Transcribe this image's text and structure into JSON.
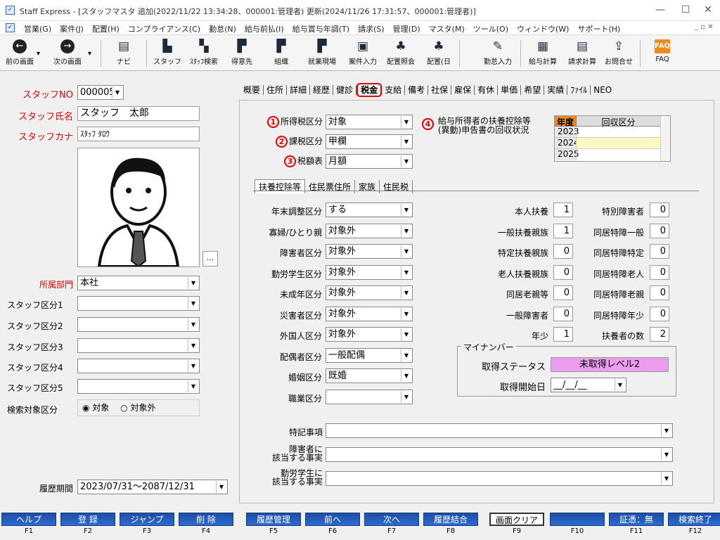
{
  "window": {
    "title": "Staff Express - [スタッフマスタ 追加(2022/11/22 13:34:28、000001:管理者) 更新(2024/11/26 17:31:57、000001:管理者)]"
  },
  "menu": [
    "営業(G)",
    "案件(J)",
    "配置(H)",
    "コンプライアンス(C)",
    "勤怠(N)",
    "給与前払(I)",
    "給与賞与年調(T)",
    "請求(S)",
    "管理(D)",
    "マスタ(M)",
    "ツール(O)",
    "ウィンドウ(W)",
    "サポート(H)"
  ],
  "toolbar": [
    {
      "label": "前の画面",
      "icon": "back-arrow"
    },
    {
      "label": "次の画面",
      "icon": "forward-arrow"
    },
    {
      "label": "ナビ",
      "icon": "navi"
    },
    {
      "label": "スタッフ",
      "icon": "staff"
    },
    {
      "label": "ｽﾀｯﾌ検索",
      "icon": "staff-search"
    },
    {
      "label": "得意先",
      "icon": "client"
    },
    {
      "label": "組織",
      "icon": "org"
    },
    {
      "label": "就業現場",
      "icon": "worksite"
    },
    {
      "label": "案件入力",
      "icon": "case-input"
    },
    {
      "label": "配置照会",
      "icon": "placement-query"
    },
    {
      "label": "配置(日",
      "icon": "placement-day"
    },
    {
      "label": "勤怠入力",
      "icon": "attendance"
    },
    {
      "label": "給与計算",
      "icon": "payroll"
    },
    {
      "label": "請求計算",
      "icon": "billing"
    },
    {
      "label": "お問合せ",
      "icon": "inquiry"
    },
    {
      "label": "FAQ",
      "icon": "faq"
    }
  ],
  "left": {
    "staff_no_label": "スタッフNO",
    "staff_no": "000005",
    "staff_name_label": "スタッフ氏名",
    "staff_name": "スタッフ　太郎",
    "staff_kana_label": "スタッフカナ",
    "staff_kana": "ｽﾀｯﾌ ﾀﾛｳ",
    "photo_button": "...",
    "dept_label": "所属部門",
    "dept": "本社",
    "kbn1_label": "スタッフ区分1",
    "kbn2_label": "スタッフ区分2",
    "kbn3_label": "スタッフ区分3",
    "kbn4_label": "スタッフ区分4",
    "kbn5_label": "スタッフ区分5",
    "search_label": "検索対象区分",
    "search_on": "対象",
    "search_off": "対象外",
    "period_label": "履歴期間",
    "period": "2023/07/31～2087/12/31"
  },
  "tabs": [
    "概要",
    "住所",
    "詳細",
    "経歴",
    "健診",
    "税金",
    "支給",
    "備考",
    "社保",
    "雇保",
    "有休",
    "単価",
    "希望",
    "実績",
    "ﾌｧｲﾙ",
    "NEO"
  ],
  "tax": {
    "n1": "1",
    "shotoku_label": "所得税区分",
    "shotoku": "対象",
    "n2": "2",
    "kazei_label": "課税区分",
    "kazei": "甲欄",
    "n3": "3",
    "zeigaku_label": "税額表",
    "zeigaku": "月額",
    "n4": "4",
    "fuyo_title1": "給与所得者の扶養控除等",
    "fuyo_title2": "(異動)申告書の回収状況",
    "year_head": "年度",
    "recv_head": "回収区分",
    "years": [
      "2023",
      "2024",
      "2025"
    ]
  },
  "subtabs": [
    "扶養控除等",
    "住民票住所",
    "家族",
    "住民税"
  ],
  "deps": {
    "left": [
      {
        "label": "年末調整区分",
        "value": "する"
      },
      {
        "label": "寡婦/ひとり親",
        "value": "対象外"
      },
      {
        "label": "障害者区分",
        "value": "対象外"
      },
      {
        "label": "勤労学生区分",
        "value": "対象外"
      },
      {
        "label": "未成年区分",
        "value": "対象外"
      },
      {
        "label": "災害者区分",
        "value": "対象外"
      },
      {
        "label": "外国人区分",
        "value": "対象外"
      },
      {
        "label": "配偶者区分",
        "value": "一般配偶"
      },
      {
        "label": "婚姻区分",
        "value": "既婚"
      },
      {
        "label": "職業区分",
        "value": ""
      }
    ],
    "mid": [
      {
        "label": "本人扶養",
        "value": "1"
      },
      {
        "label": "一般扶養親族",
        "value": "1"
      },
      {
        "label": "特定扶養親族",
        "value": "0"
      },
      {
        "label": "老人扶養親族",
        "value": "0"
      },
      {
        "label": "同居老親等",
        "value": "0"
      },
      {
        "label": "一般障害者",
        "value": "0"
      },
      {
        "label": "年少",
        "value": "1"
      }
    ],
    "right": [
      {
        "label": "特別障害者",
        "value": "0"
      },
      {
        "label": "同居特障一般",
        "value": "0"
      },
      {
        "label": "同居特障特定",
        "value": "0"
      },
      {
        "label": "同居特障老人",
        "value": "0"
      },
      {
        "label": "同居特障老親",
        "value": "0"
      },
      {
        "label": "同居特障年少",
        "value": "0"
      },
      {
        "label": "扶養者の数",
        "value": "2"
      }
    ]
  },
  "mynumber": {
    "group": "マイナンバー",
    "status_label": "取得ステータス",
    "status": "未取得レベル2",
    "start_label": "取得開始日",
    "start": "__/__/__"
  },
  "notes": {
    "tokki": "特記事項",
    "shogai1": "障害者に",
    "shogai2": "該当する事実",
    "kinro1": "勤労学生に",
    "kinro2": "該当する事実"
  },
  "fkeys": [
    {
      "label": "ヘルプ",
      "key": "F1"
    },
    {
      "label": "登 録",
      "key": "F2"
    },
    {
      "label": "ジャンプ",
      "key": "F3"
    },
    {
      "label": "削 除",
      "key": "F4"
    },
    {
      "label": "履歴管理",
      "key": "F5"
    },
    {
      "label": "前へ",
      "key": "F6"
    },
    {
      "label": "次へ",
      "key": "F7"
    },
    {
      "label": "履歴結合",
      "key": "F8"
    },
    {
      "label": "画面クリア",
      "key": "F9"
    },
    {
      "label": "",
      "key": "F10"
    },
    {
      "label": "証憑：無",
      "key": "F11"
    },
    {
      "label": "検索終了",
      "key": "F12"
    }
  ]
}
